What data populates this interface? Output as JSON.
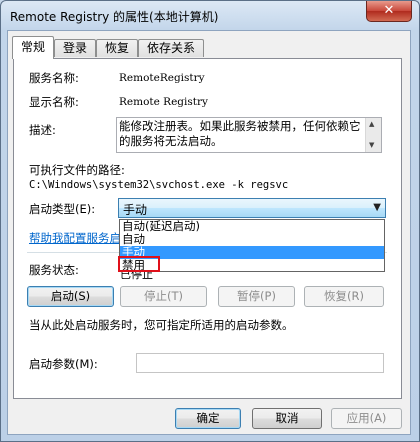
{
  "window": {
    "title": "Remote Registry 的属性(本地计算机)",
    "close_glyph": "✕"
  },
  "tabs": [
    "常规",
    "登录",
    "恢复",
    "依存关系"
  ],
  "general": {
    "service_name_label": "服务名称:",
    "service_name": "RemoteRegistry",
    "display_name_label": "显示名称:",
    "display_name": "Remote Registry",
    "description_label": "描述:",
    "description": "能修改注册表。如果此服务被禁用，任何依赖它的服务将无法启动。",
    "path_label": "可执行文件的路径:",
    "path": "C:\\Windows\\system32\\svchost.exe -k regsvc",
    "startup_type_label": "启动类型(E):",
    "startup_type_value": "手动",
    "startup_options": [
      "自动(延迟启动)",
      "自动",
      "手动",
      "禁用"
    ],
    "selected_option_index": 2,
    "help_link": "帮助我配置服务启",
    "service_status_label": "服务状态:",
    "service_status_value": "已停止",
    "start_button": "启动(S)",
    "stop_button": "停止(T)",
    "pause_button": "暂停(P)",
    "resume_button": "恢复(R)",
    "hint": "当从此处启动服务时，您可指定所适用的启动参数。",
    "start_params_label": "启动参数(M):",
    "start_params_value": ""
  },
  "footer": {
    "ok_button": "确定",
    "cancel_button": "取消",
    "apply_button": "应用(A)"
  },
  "colors": {
    "selection": "#3399ff",
    "highlight_box": "#e0101a",
    "link": "#0066cc"
  }
}
